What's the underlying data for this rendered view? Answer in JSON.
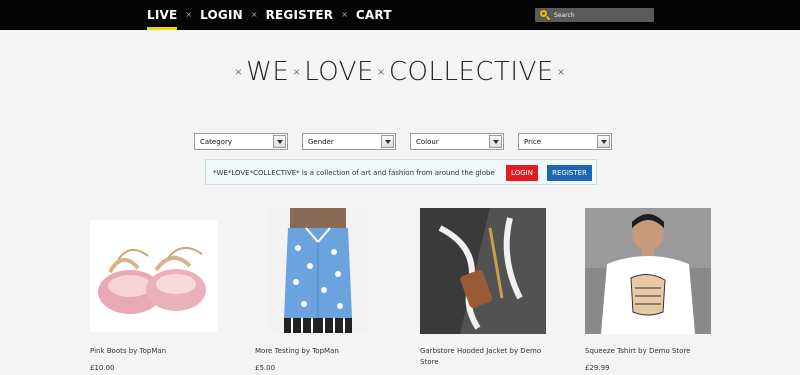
{
  "nav": {
    "items": [
      {
        "label": "LIVE",
        "active": true
      },
      {
        "label": "LOGIN",
        "active": false
      },
      {
        "label": "REGISTER",
        "active": false
      },
      {
        "label": "CART",
        "active": false
      }
    ],
    "separator": "×"
  },
  "search": {
    "placeholder": "Search",
    "icon": "search-icon"
  },
  "logo": {
    "parts": [
      "WE",
      "LOVE",
      "COLLECTIVE"
    ],
    "separator": "×"
  },
  "filters": [
    {
      "label": "Category"
    },
    {
      "label": "Gender"
    },
    {
      "label": "Colour"
    },
    {
      "label": "Price"
    }
  ],
  "banner": {
    "text": "*WE*LOVE*COLLECTIVE* is a collection of art and fashion from around the globe",
    "login_label": "LOGIN",
    "register_label": "REGISTER"
  },
  "products": [
    {
      "title": "Pink Boots by TopMan",
      "price": "£10.00"
    },
    {
      "title": "More Testing by TopMan",
      "price": "£5.00"
    },
    {
      "title": "Garbstore Hooded Jacket by Demo Store",
      "price": ""
    },
    {
      "title": "Squeeze Tshirt by Demo Store",
      "price": "£29.99"
    }
  ],
  "colors": {
    "topbar": "#050505",
    "active_underline": "#f0d800",
    "login_button": "#e01b22",
    "register_button": "#1c66b4",
    "background": "#f4f4f4"
  }
}
